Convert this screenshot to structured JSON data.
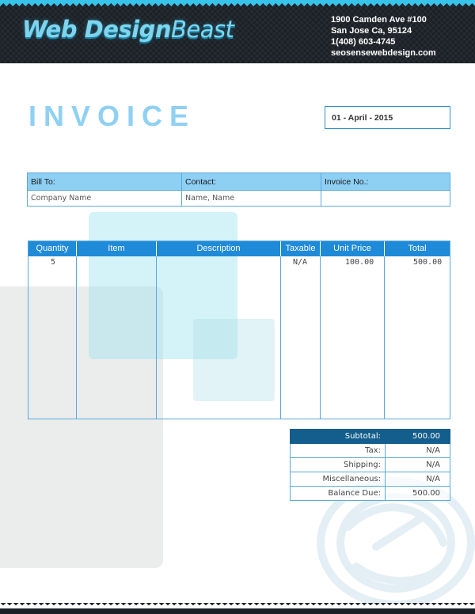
{
  "company": {
    "logo_part1": "Web Design",
    "logo_part2": "Beast",
    "address": [
      "1900 Camden Ave #100",
      "San Jose Ca, 95124",
      "1(408) 603-4745",
      "seosensewebdesign.com"
    ]
  },
  "colors": {
    "header_bg": "#1b2026",
    "accent": "#37c3ea",
    "title": "#8fd0f3",
    "table_header": "#1f8ad8",
    "bill_header": "#8ecff4",
    "totals_header": "#135e8c"
  },
  "title": "INVOICE",
  "date": "01 - April - 2015",
  "bill_table": {
    "headers": [
      "Bill To:",
      "Contact:",
      "Invoice No.:"
    ],
    "values": [
      "Company Name",
      "Name, Name",
      ""
    ]
  },
  "items_table": {
    "headers": [
      "Quantity",
      "Item",
      "Description",
      "Taxable",
      "Unit Price",
      "Total"
    ],
    "rows": [
      {
        "quantity": "5",
        "item": "",
        "description": "",
        "taxable": "N/A",
        "unit_price": "100.00",
        "total": "500.00"
      }
    ]
  },
  "totals": [
    {
      "label": "Subtotal:",
      "value": "500.00"
    },
    {
      "label": "Tax:",
      "value": "N/A"
    },
    {
      "label": "Shipping:",
      "value": "N/A"
    },
    {
      "label": "Miscellaneous:",
      "value": "N/A"
    },
    {
      "label": "Balance Due:",
      "value": "500.00"
    }
  ],
  "icons": {
    "watermark": "swirl-logo-watermark-icon"
  }
}
